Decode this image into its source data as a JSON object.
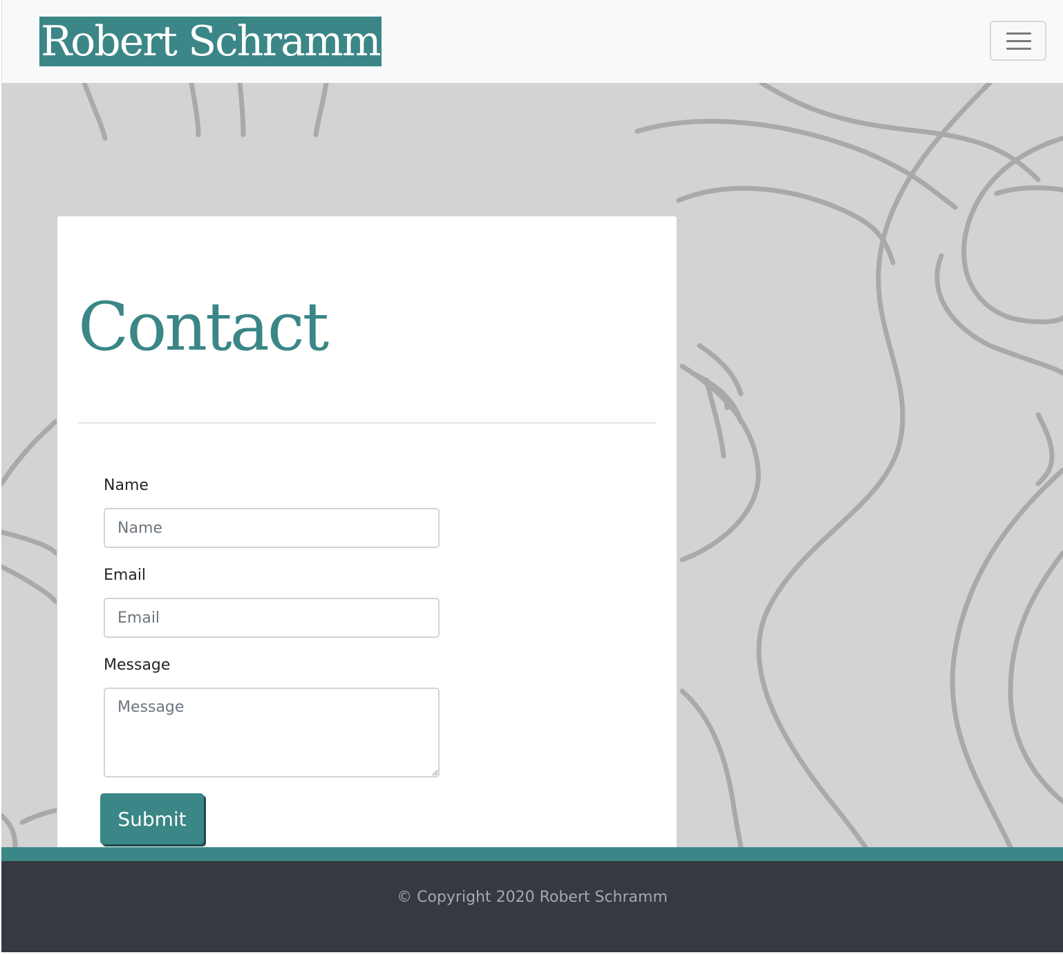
{
  "header": {
    "brand": "Robert Schramm",
    "menu_icon": "hamburger-menu-icon"
  },
  "contact": {
    "title": "Contact",
    "fields": {
      "name": {
        "label": "Name",
        "placeholder": "Name",
        "value": ""
      },
      "email": {
        "label": "Email",
        "placeholder": "Email",
        "value": ""
      },
      "message": {
        "label": "Message",
        "placeholder": "Message",
        "value": ""
      }
    },
    "submit_label": "Submit"
  },
  "footer": {
    "copyright": "© Copyright 2020 Robert Schramm"
  },
  "colors": {
    "accent": "#3b8686",
    "navbar_bg": "#f8f9fa",
    "background": "#d3d3d3",
    "footer_bg": "#343a40",
    "footer_text": "#a5a9ad"
  }
}
